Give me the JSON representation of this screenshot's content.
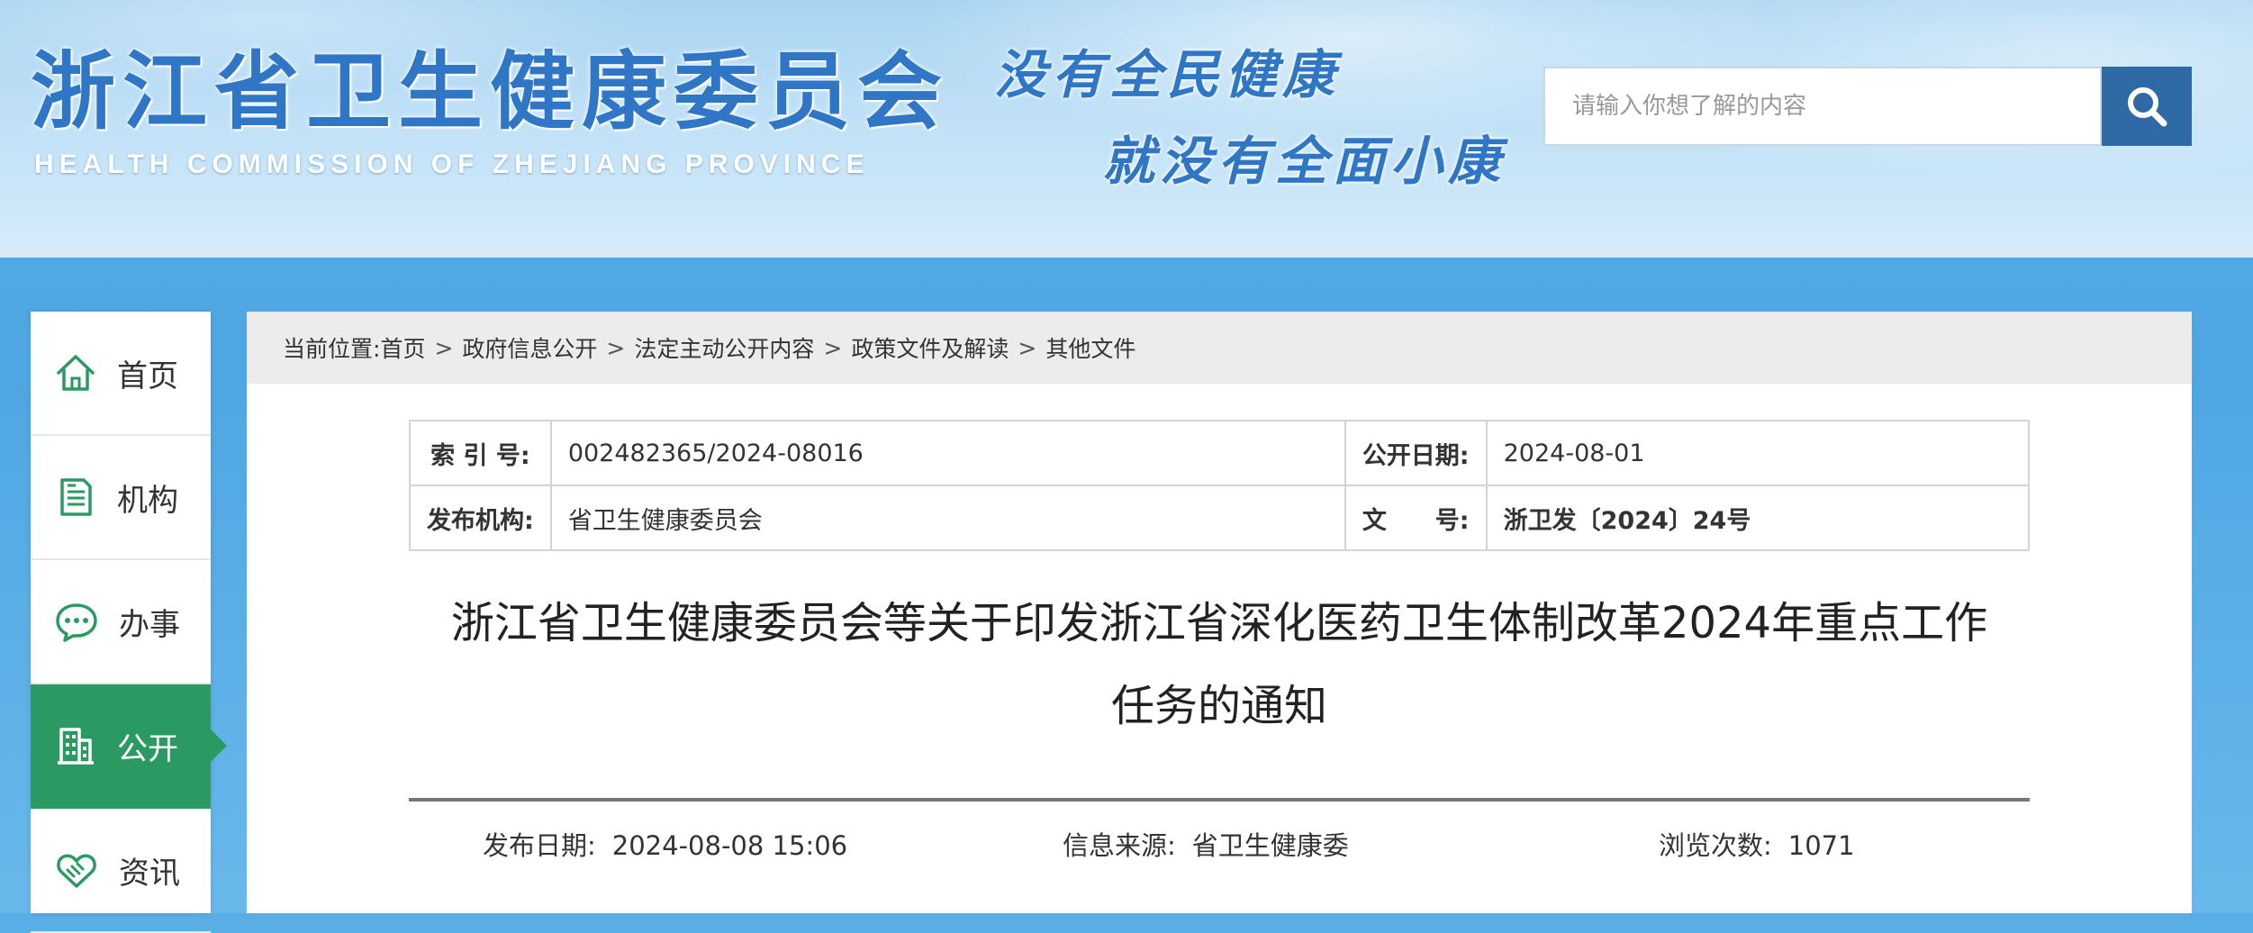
{
  "header": {
    "title": "浙江省卫生健康委员会",
    "subtitle": "HEALTH COMMISSION OF ZHEJIANG PROVINCE",
    "slogan_line1": "没有全民健康",
    "slogan_line2": "就没有全面小康",
    "search_placeholder": "请输入你想了解的内容",
    "search_icon": "search-icon"
  },
  "sidebar": {
    "items": [
      {
        "label": "首页",
        "icon": "home-icon"
      },
      {
        "label": "机构",
        "icon": "document-icon"
      },
      {
        "label": "办事",
        "icon": "chat-icon"
      },
      {
        "label": "公开",
        "icon": "building-icon",
        "active": true
      },
      {
        "label": "资讯",
        "icon": "handshake-icon"
      }
    ],
    "active_color": "#2a9a62"
  },
  "breadcrumb": {
    "prefix": "当前位置:",
    "items": [
      "首页",
      "政府信息公开",
      "法定主动公开内容",
      "政策文件及解读",
      "其他文件"
    ],
    "separator": ">"
  },
  "meta": {
    "index_label": "索 引 号:",
    "index_value": "002482365/2024-08016",
    "date_label": "公开日期:",
    "date_value": "2024-08-01",
    "org_label": "发布机构:",
    "org_value": "省卫生健康委员会",
    "docno_label": "文　　号:",
    "docno_value": "浙卫发〔2024〕24号"
  },
  "article": {
    "title_line1": "浙江省卫生健康委员会等关于印发浙江省深化医药卫生体制改革2024年重点工作",
    "title_line2": "任务的通知",
    "publish_label": "发布日期:",
    "publish_value": "2024-08-08 15:06",
    "source_label": "信息来源:",
    "source_value": "省卫生健康委",
    "views_label": "浏览次数:",
    "views_value": "1071"
  }
}
